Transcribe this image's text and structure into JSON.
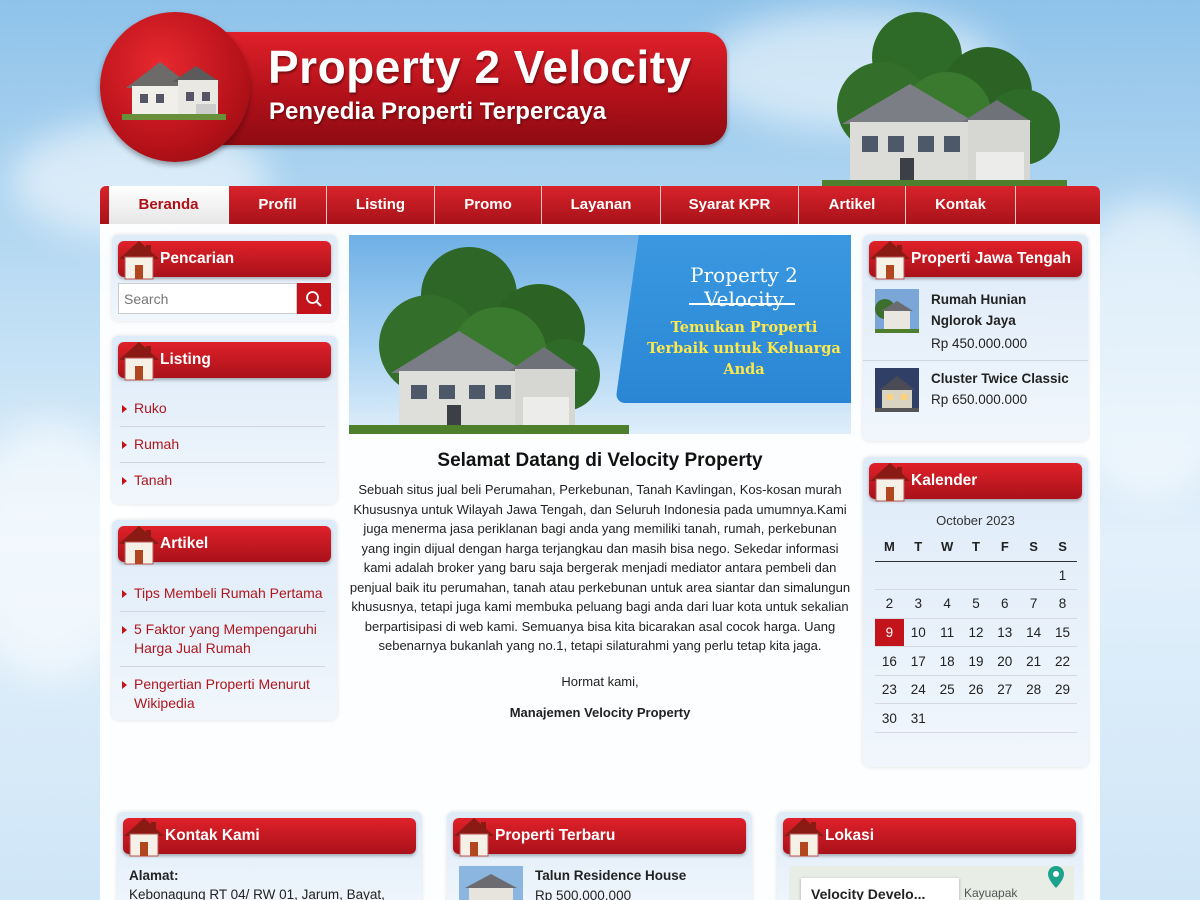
{
  "site": {
    "title": "Property 2 Velocity",
    "tagline": "Penyedia Properti Terpercaya"
  },
  "nav": [
    {
      "label": "Beranda"
    },
    {
      "label": "Profil"
    },
    {
      "label": "Listing"
    },
    {
      "label": "Promo"
    },
    {
      "label": "Layanan"
    },
    {
      "label": "Syarat KPR"
    },
    {
      "label": "Artikel"
    },
    {
      "label": "Kontak"
    }
  ],
  "sidebar": {
    "search": {
      "title": "Pencarian",
      "placeholder": "Search"
    },
    "listing": {
      "title": "Listing",
      "items": [
        "Ruko",
        "Rumah",
        "Tanah"
      ]
    },
    "artikel": {
      "title": "Artikel",
      "items": [
        "Tips Membeli Rumah Pertama",
        "5 Faktor yang Mempengaruhi Harga Jual Rumah",
        "Pengertian Properti Menurut Wikipedia"
      ]
    }
  },
  "banner": {
    "title": "Property 2 Velocity",
    "subtitle": "Temukan Properti Terbaik untuk Keluarga Anda"
  },
  "content": {
    "heading": "Selamat Datang di Velocity Property",
    "body": "Sebuah situs jual beli Perumahan, Perkebunan, Tanah Kavlingan, Kos-kosan murah Khususnya untuk Wilayah Jawa Tengah, dan Seluruh Indonesia pada umumnya.Kami juga menerma jasa periklanan bagi anda yang memiliki tanah, rumah, perkebunan yang ingin dijual dengan harga terjangkau dan masih bisa nego. Sekedar informasi kami adalah broker yang baru saja  bergerak menjadi mediator antara pembeli dan penjual baik itu perumahan, tanah atau perkebunan untuk area siantar dan simalungun khususnya, tetapi juga kami membuka peluang bagi anda dari luar kota untuk sekalian berpartisipasi di web kami. Semuanya bisa kita bicarakan asal cocok harga. Uang sebenarnya bukanlah yang no.1, tetapi silaturahmi yang perlu tetap kita jaga.",
    "closing": "Hormat kami,",
    "signature": "Manajemen Velocity Property"
  },
  "properti_jateng": {
    "title": "Properti Jawa Tengah",
    "items": [
      {
        "name": "Rumah Hunian Nglorok Jaya",
        "price": "Rp 450.000.000"
      },
      {
        "name": "Cluster Twice Classic",
        "price": "Rp 650.000.000"
      }
    ]
  },
  "kalender": {
    "title": "Kalender",
    "month": "October 2023",
    "days": [
      "M",
      "T",
      "W",
      "T",
      "F",
      "S",
      "S"
    ],
    "weeks": [
      [
        "",
        "",
        "",
        "",
        "",
        "",
        "1"
      ],
      [
        "2",
        "3",
        "4",
        "5",
        "6",
        "7",
        "8"
      ],
      [
        "9",
        "10",
        "11",
        "12",
        "13",
        "14",
        "15"
      ],
      [
        "16",
        "17",
        "18",
        "19",
        "20",
        "21",
        "22"
      ],
      [
        "23",
        "24",
        "25",
        "26",
        "27",
        "28",
        "29"
      ],
      [
        "30",
        "31",
        "",
        "",
        "",
        "",
        ""
      ]
    ],
    "today": "9"
  },
  "footer": {
    "kontak": {
      "title": "Kontak Kami",
      "label": "Alamat:",
      "address": "Kebonagung RT 04/ RW 01, Jarum, Bayat,"
    },
    "terbaru": {
      "title": "Properti Terbaru",
      "name": "Talun Residence House",
      "price": "Rp 500.000.000"
    },
    "lokasi": {
      "title": "Lokasi",
      "place": "Velocity Develo...",
      "town": "Kayuapak"
    }
  },
  "colors": {
    "brand_red": "#c3141c",
    "nav_red": "#a8121a",
    "link_red": "#b0161d"
  }
}
